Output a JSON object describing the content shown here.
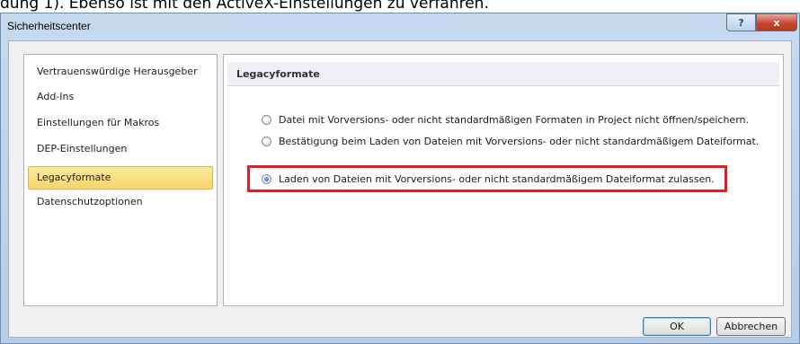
{
  "background": {
    "caption": "dung 1). Ebenso ist mit den ActiveX-Einstellungen zu verfahren."
  },
  "window": {
    "title": "Sicherheitscenter",
    "help_symbol": "?",
    "close_symbol": "x"
  },
  "sidebar": {
    "items": [
      {
        "label": "Vertrauenswürdige Herausgeber",
        "selected": false
      },
      {
        "label": "Add-Ins",
        "selected": false
      },
      {
        "label": "Einstellungen für Makros",
        "selected": false
      },
      {
        "label": "DEP-Einstellungen",
        "selected": false
      },
      {
        "label": "Legacyformate",
        "selected": true
      },
      {
        "label": "Datenschutzoptionen",
        "selected": false
      }
    ]
  },
  "main": {
    "section_title": "Legacyformate",
    "options": [
      {
        "label": "Datei mit Vorversions- oder nicht standardmäßigen Formaten in Project nicht öffnen/speichern.",
        "checked": false
      },
      {
        "label": "Bestätigung beim Laden von Dateien mit Vorversions- oder nicht standardmäßigem Dateiformat.",
        "checked": false
      },
      {
        "label": "Laden von Dateien mit Vorversions- oder nicht standardmäßigem Dateiformat zulassen.",
        "checked": true
      }
    ]
  },
  "footer": {
    "ok_label": "OK",
    "cancel_label": "Abbrechen"
  },
  "colors": {
    "highlight": "#e21f26",
    "selection": "#f8d46a"
  }
}
